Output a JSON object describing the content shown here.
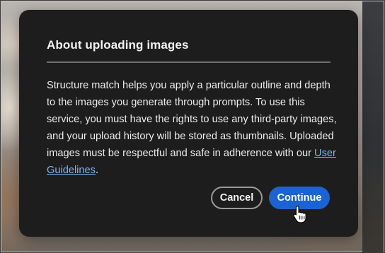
{
  "dialog": {
    "title": "About uploading images",
    "body_text": "Structure match helps you apply a particular outline and depth to the images you generate through prompts. To use this service, you must have the rights to use any third-party images, and your upload history will be stored as thumbnails. Uploaded images must be respectful and safe in adherence with our ",
    "link_text": "User Guidelines",
    "body_suffix": ".",
    "cancel_label": "Cancel",
    "continue_label": "Continue"
  },
  "colors": {
    "dialog_background": "#1d1d1d",
    "link": "#7db3f6",
    "primary_button": "#1b63d3"
  },
  "icons": {
    "cursor": "hand-pointer-icon"
  }
}
